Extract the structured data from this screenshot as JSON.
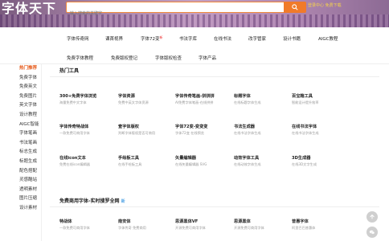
{
  "header": {
    "logo": "字体天下",
    "search_placeholder": "输入搜索的关键字",
    "top_links": "登录中心 免费下载"
  },
  "nav": {
    "row1": [
      "字体传奇网",
      "课首视界",
      "字体72变",
      "书法字库",
      "在线书法",
      "改字管家",
      "设计书籍",
      "AIGC教程"
    ],
    "row2": [
      "免费字体教程",
      "免费版权登记",
      "字体版权检查",
      "字体产品"
    ],
    "hot_mark": "新"
  },
  "sidebar": {
    "items": [
      "热门推荐",
      "免费字体",
      "免费英文",
      "免费图片",
      "英文字体",
      "设计教程",
      "AIGC智能",
      "字体笔画",
      "书法笔画",
      "标志生成",
      "标题生成",
      "配色搭配",
      "灵感酷站",
      "透明素材",
      "图片压缩",
      "设计素材"
    ]
  },
  "sections": [
    {
      "title": "热门工具",
      "badge": "",
      "cards": [
        {
          "t": "300+免费字体浏览",
          "d": "海量免费中文字体"
        },
        {
          "t": "字体资源",
          "d": "免费中英文字体资源"
        },
        {
          "t": "字体传奇笔画-拼拼拼",
          "d": "AI免费字体笔画-在线拼拼"
        },
        {
          "t": "标题字体",
          "d": "在线标题字体生成"
        },
        {
          "t": "百宝箱工具",
          "d": "智能设计提升效率"
        },
        {
          "t": "字体传奇特战体",
          "d": "一款免费可商用字体"
        },
        {
          "t": "查字体版权",
          "d": "判断字体版权是否可商用"
        },
        {
          "t": "字体72变-变变变",
          "d": "字体72变 在线预览"
        },
        {
          "t": "书法生成器",
          "d": "在线书法字体生成"
        },
        {
          "t": "在线书法字体",
          "d": "在线书法字体生成"
        },
        {
          "t": "在线icon文本",
          "d": "免费在线icon编辑器"
        },
        {
          "t": "手绘板工具",
          "d": "在线手绘板工具"
        },
        {
          "t": "矢量编辑器",
          "d": "在线矢量编辑器 SVG"
        },
        {
          "t": "动效字体工具",
          "d": "在线动效字体生成"
        },
        {
          "t": "3D生成器",
          "d": "在线3D文字生成"
        }
      ]
    },
    {
      "title": "免费商用字体-实时搜罗全网",
      "badge": "新",
      "cards": [
        {
          "t": "特战体",
          "d": "一款免费可商用字体"
        },
        {
          "t": "南安体",
          "d": "字体传奇 免费商用"
        },
        {
          "t": "思源黑体VF",
          "d": "开源免费可商用字体"
        },
        {
          "t": "思源黑体",
          "d": "开源免费可商用字体"
        },
        {
          "t": "普惠字体",
          "d": "阿里巴巴普惠体"
        }
      ]
    }
  ],
  "float": {
    "top_icon": "arrow-up-icon",
    "chat_icon": "wechat-icon"
  },
  "colors": {
    "accent": "#f07a2a",
    "active": "#e65a1a"
  }
}
